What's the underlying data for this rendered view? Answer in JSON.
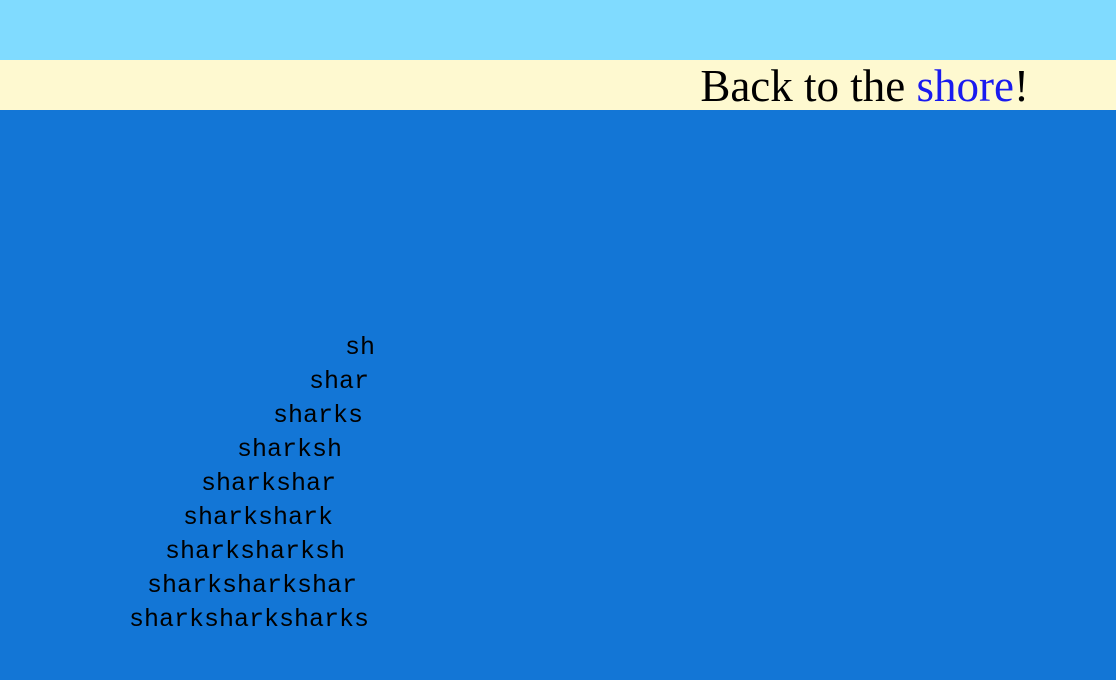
{
  "banner": {
    "prefix": "Back to the ",
    "link": "shore",
    "suffix": "!"
  },
  "shark": {
    "lines": [
      "sh",
      "shar",
      "sharks",
      "sharksh",
      "sharkshar",
      "sharkshark",
      "sharksharksh",
      "sharksharkshar",
      "sharksharksharks"
    ]
  },
  "colors": {
    "sky": "#80dbff",
    "banner": "#fef9d0",
    "sea": "#1376d6",
    "link": "#1a1aef"
  }
}
